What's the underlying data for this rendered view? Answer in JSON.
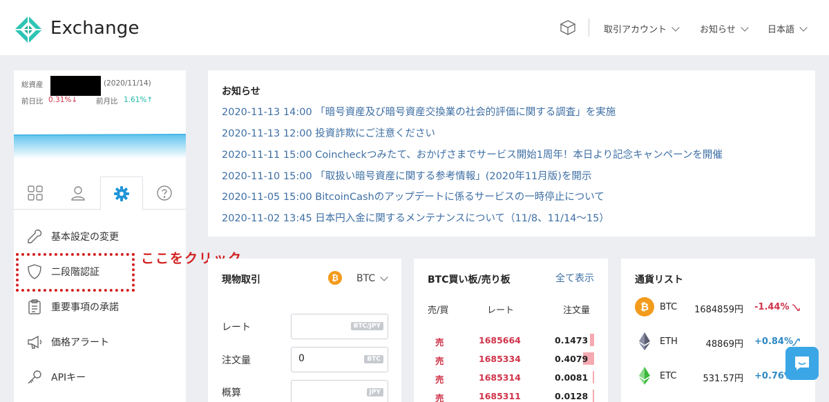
{
  "header": {
    "brand": "Exchange",
    "nav": [
      "取引アカウント",
      "お知らせ",
      "日本語"
    ]
  },
  "assets": {
    "total_label": "総資産",
    "date": "(2020/11/14)",
    "day_label": "前日比",
    "day_value": "0.31%↓",
    "month_label": "前月比",
    "month_value": "1.61%↑"
  },
  "menu": {
    "items": [
      "基本設定の変更",
      "二段階認証",
      "重要事項の承諾",
      "価格アラート",
      "APIキー"
    ]
  },
  "annotation": "ここをクリック",
  "notices": {
    "title": "お知らせ",
    "items": [
      "2020-11-13 14:00 「暗号資産及び暗号資産交換業の社会的評価に関する調査」を実施",
      "2020-11-13 12:00 投資詐欺にご注意ください",
      "2020-11-11 15:00 Coincheckつみたて、おかげさまでサービス開始1周年！本日より記念キャンペーンを開催",
      "2020-11-10 15:00 「取扱い暗号資産に関する参考情報」(2020年11月版)を開示",
      "2020-11-05 15:00 BitcoinCashのアップデートに係るサービスの一時停止について",
      "2020-11-02 13:45 日本円入金に関するメンテナンスについて（11/8、11/14〜15）"
    ]
  },
  "trade": {
    "title": "現物取引",
    "pair_icon": "₿",
    "pair": "BTC",
    "rate_label": "レート",
    "rate_unit": "BTC/JPY",
    "qty_label": "注文量",
    "qty_value": "0",
    "qty_unit": "BTC",
    "est_label": "概算",
    "est_unit": "JPY"
  },
  "book": {
    "title": "BTC買い板/売り板",
    "show_all": "全て表示",
    "headers": [
      "売/買",
      "レート",
      "注文量"
    ],
    "rows": [
      {
        "side": "売",
        "rate": "1685664",
        "qty": "0.1473",
        "depth": 0.147
      },
      {
        "side": "売",
        "rate": "1685334",
        "qty": "0.4079",
        "depth": 0.408
      },
      {
        "side": "売",
        "rate": "1685314",
        "qty": "0.0081",
        "depth": 0.008
      },
      {
        "side": "売",
        "rate": "1685311",
        "qty": "0.0128",
        "depth": 0.013
      }
    ]
  },
  "coins": {
    "title": "通貨リスト",
    "rows": [
      {
        "symbol": "BTC",
        "icon": "₿",
        "price": "1684859円",
        "change": "-1.44%",
        "dir": "down"
      },
      {
        "symbol": "ETH",
        "icon": "",
        "price": "48869円",
        "change": "+0.84%",
        "dir": "up"
      },
      {
        "symbol": "ETC",
        "icon": "",
        "price": "531.57円",
        "change": "+0.76%",
        "dir": "up"
      }
    ]
  },
  "colors": {
    "brand": "#1fb7a7",
    "link": "#3e6fa4",
    "sell": "#d0344a",
    "annotation": "#d21f1f",
    "chat": "#3aa6e6"
  }
}
